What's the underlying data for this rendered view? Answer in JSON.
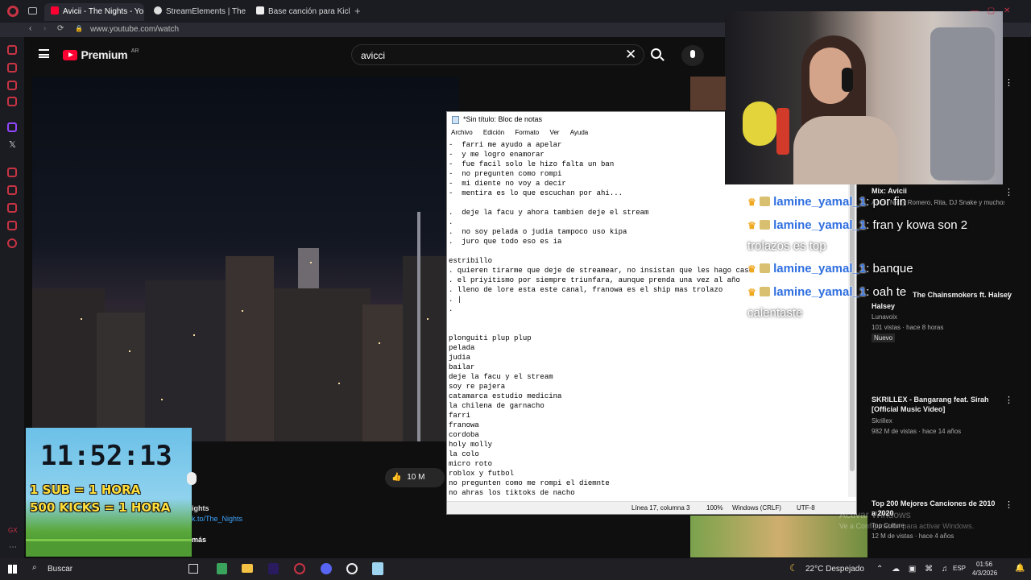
{
  "browser": {
    "tabs": [
      {
        "label": "Avicii - The Nights - Yo",
        "active": true
      },
      {
        "label": "StreamElements | The Ulti",
        "active": false
      },
      {
        "label": "Base canción para Kick",
        "active": false
      }
    ],
    "url": "www.youtube.com/watch"
  },
  "youtube": {
    "brand": "Premium",
    "region": "AR",
    "search_value": "avicci",
    "likes": "10 M",
    "description_fragments": [
      "ights",
      "k.to/The_Nights",
      "más"
    ]
  },
  "timer": {
    "time": "11:52:13",
    "line1": "1 SUB = 1 HORA",
    "line2": "500 KICKS = 1 HORA"
  },
  "notepad": {
    "title": "*Sin título: Bloc de notas",
    "menu": [
      "Archivo",
      "Edición",
      "Formato",
      "Ver",
      "Ayuda"
    ],
    "lines": [
      "-  farri me ayudo a apelar",
      "-  y me logro enamorar",
      "-  fue facil solo le hizo falta un ban",
      "-  no pregunten como rompi",
      "-  mi diente no voy a decir",
      "-  mentira es lo que escuchan por ahi...",
      "",
      ".  deje la facu y ahora tambien deje el stream",
      ".",
      ".  no soy pelada o judia tampoco uso kipa",
      ".  juro que todo eso es ia",
      "",
      "estribillo",
      ". quieren tirarme que deje de streamear, no insistan que les hago caso",
      ". el priyitismo por siempre triunfara, aunque prenda una vez al año",
      ". lleno de lore esta este canal, franowa es el ship mas trolazo",
      ". |",
      ".",
      "",
      "",
      "plonguiti plup plup",
      "pelada",
      "judia",
      "bailar",
      "deje la facu y el stream",
      "soy re pajera",
      "catamarca estudio medicina",
      "la chilena de garnacho",
      "farri",
      "franowa",
      "cordoba",
      "holy molly",
      "la colo",
      "micro roto",
      "roblox y futbol",
      "no pregunten como me rompi el diemnte",
      "no ahras los tiktoks de nacho"
    ],
    "status": {
      "position": "Línea 17, columna 3",
      "zoom": "100%",
      "eol": "Windows (CRLF)",
      "encoding": "UTF-8"
    }
  },
  "chat": [
    {
      "user": "lamine_yamal_1",
      "message": ": por fin",
      "extra": ""
    },
    {
      "user": "lamine_yamal_1",
      "message": ": fran y kowa son 2",
      "extra": "trolazos es top"
    },
    {
      "user": "lamine_yamal_1",
      "message": ": banque",
      "extra": ""
    },
    {
      "user": "lamine_yamal_1",
      "message": ": oah te",
      "extra": "calentaste"
    }
  ],
  "recommendations": [
    {
      "title": "Mix: Avicii",
      "meta": "Avicii, Nicky Romero, Rita, DJ Snake y muchos más",
      "extra": ""
    },
    {
      "title": "The Chainsmokers ft. Halsey",
      "meta": "Lunavoix",
      "meta2": "101 vistas · hace 8 horas",
      "badge": "Nuevo"
    },
    {
      "title": "SKRILLEX - Bangarang feat. Sirah [Official Music Video]",
      "meta": "Skrillex",
      "meta2": "982 M de vistas · hace 14 años"
    },
    {
      "title": "Top 200 Mejores Canciones de 2010 a 2020",
      "meta": "Top Culture",
      "meta2": "12 M de vistas · hace 4 años"
    }
  ],
  "watermark": {
    "line1": "Activar Windows",
    "line2": "Ve a Configuración para activar Windows."
  },
  "taskbar": {
    "search_label": "Buscar",
    "weather": "22°C  Despejado",
    "lang": "ESP",
    "time": "01:56",
    "date": "4/3/2026"
  },
  "colors": {
    "youtube_red": "#ff0033",
    "chat_user": "#2f6fe0",
    "opera_red": "#c73444"
  }
}
